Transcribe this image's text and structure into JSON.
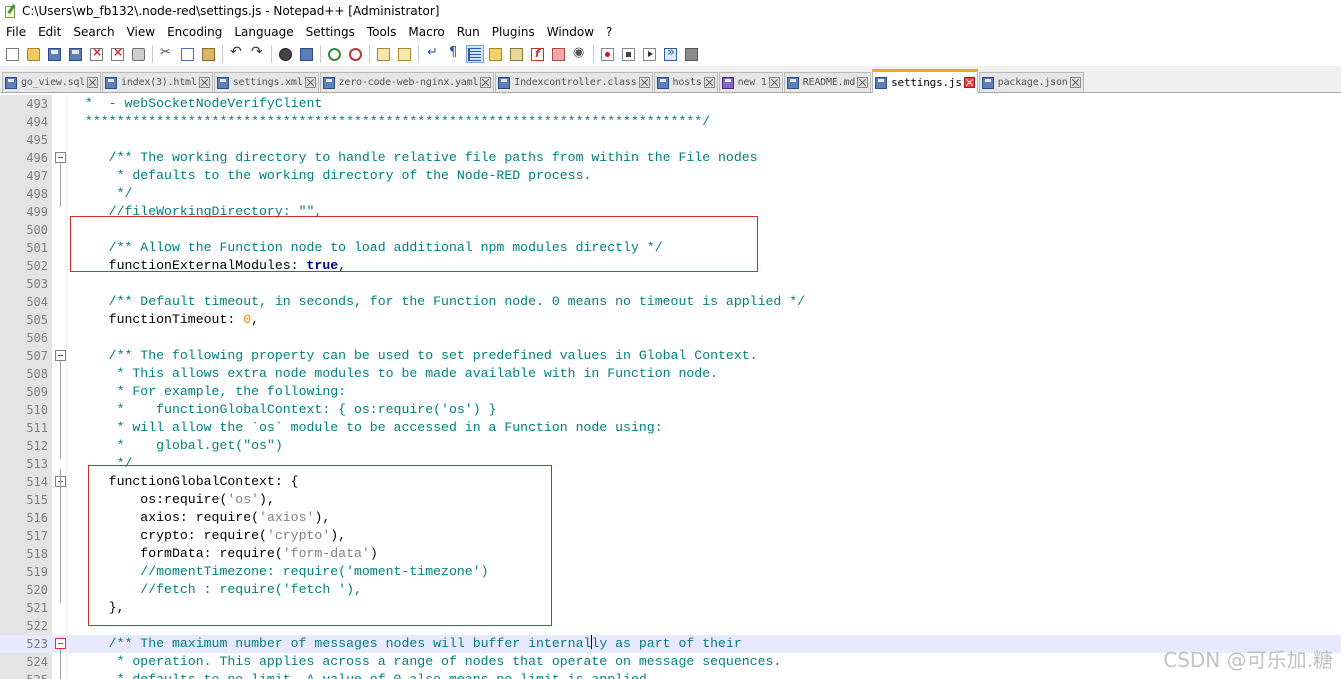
{
  "window": {
    "title": "C:\\Users\\wb_fb132\\.node-red\\settings.js - Notepad++ [Administrator]"
  },
  "menu": [
    "File",
    "Edit",
    "Search",
    "View",
    "Encoding",
    "Language",
    "Settings",
    "Tools",
    "Macro",
    "Run",
    "Plugins",
    "Window",
    "?"
  ],
  "toolbar": {
    "buttons": [
      {
        "name": "new-file-icon",
        "kind": "ic-doc"
      },
      {
        "name": "open-file-icon",
        "kind": "ic-folder"
      },
      {
        "name": "save-icon",
        "kind": "ic-disk"
      },
      {
        "name": "save-all-icon",
        "kind": "ic-disk"
      },
      {
        "name": "close-file-icon",
        "kind": "ic-x"
      },
      {
        "name": "close-all-icon",
        "kind": "ic-x"
      },
      {
        "name": "print-icon",
        "kind": "ic-printer"
      },
      {
        "sep": true
      },
      {
        "name": "cut-icon",
        "kind": "ic-scissors"
      },
      {
        "name": "copy-icon",
        "kind": "ic-copy"
      },
      {
        "name": "paste-icon",
        "kind": "ic-paste"
      },
      {
        "sep": true
      },
      {
        "name": "undo-icon",
        "kind": "ic-undo"
      },
      {
        "name": "redo-icon",
        "kind": "ic-redo"
      },
      {
        "sep": true
      },
      {
        "name": "find-icon",
        "kind": "ic-find"
      },
      {
        "name": "replace-icon",
        "kind": "ic-replace"
      },
      {
        "sep": true
      },
      {
        "name": "zoom-in-icon",
        "kind": "ic-zoomin"
      },
      {
        "name": "zoom-out-icon",
        "kind": "ic-zoomout"
      },
      {
        "sep": true
      },
      {
        "name": "sync-vertical-icon",
        "kind": "ic-sync"
      },
      {
        "name": "sync-horizontal-icon",
        "kind": "ic-sync"
      },
      {
        "sep": true
      },
      {
        "name": "word-wrap-icon",
        "kind": "ic-wrap"
      },
      {
        "name": "show-all-chars-icon",
        "kind": "ic-pilcrow"
      },
      {
        "name": "indent-guide-icon",
        "kind": "ic-indent",
        "active": true
      },
      {
        "name": "user-language-icon",
        "kind": "ic-lang"
      },
      {
        "name": "document-map-icon",
        "kind": "ic-map"
      },
      {
        "name": "function-list-icon",
        "kind": "ic-fx"
      },
      {
        "name": "folder-as-workspace-icon",
        "kind": "ic-openfolder"
      },
      {
        "name": "monitoring-icon",
        "kind": "ic-eye"
      },
      {
        "sep": true
      },
      {
        "name": "record-macro-icon",
        "kind": "ic-rec"
      },
      {
        "name": "stop-recording-icon",
        "kind": "ic-stop"
      },
      {
        "name": "playback-macro-icon",
        "kind": "ic-play"
      },
      {
        "name": "run-macro-multiple-icon",
        "kind": "ic-ff"
      },
      {
        "name": "save-macro-icon",
        "kind": "ic-savemacro"
      }
    ]
  },
  "tabs": [
    {
      "label": "go_view.sql",
      "icon": "disk",
      "active": false
    },
    {
      "label": "index(3).html",
      "icon": "disk",
      "active": false
    },
    {
      "label": "settings.xml",
      "icon": "disk",
      "active": false
    },
    {
      "label": "zero-code-web-nginx.yaml",
      "icon": "disk",
      "active": false
    },
    {
      "label": "Indexcontroller.class",
      "icon": "disk",
      "active": false
    },
    {
      "label": "hosts",
      "icon": "disk",
      "active": false
    },
    {
      "label": "new 1",
      "icon": "purple",
      "active": false
    },
    {
      "label": "README.md",
      "icon": "disk",
      "active": false
    },
    {
      "label": "settings.js",
      "icon": "disk",
      "active": true
    },
    {
      "label": "package.json",
      "icon": "disk",
      "active": false
    }
  ],
  "editor": {
    "lines": [
      {
        "n": "493",
        "fold": "",
        "segs": [
          [
            "c-comment",
            " *  - webSocketNodeVerifyClient"
          ]
        ]
      },
      {
        "n": "494",
        "fold": "",
        "segs": [
          [
            "c-comment",
            " ******************************************************************************/"
          ]
        ]
      },
      {
        "n": "495",
        "fold": "",
        "segs": []
      },
      {
        "n": "496",
        "fold": "box",
        "segs": [
          [
            "c-comment",
            "    /** The working directory to handle relative file paths from within the File nodes"
          ]
        ]
      },
      {
        "n": "497",
        "fold": "",
        "segs": [
          [
            "c-comment",
            "     * defaults to the working directory of the Node-RED process."
          ]
        ]
      },
      {
        "n": "498",
        "fold": "",
        "segs": [
          [
            "c-comment",
            "     */"
          ]
        ]
      },
      {
        "n": "499",
        "fold": "",
        "segs": [
          [
            "c-comment",
            "    //fileWorkingDirectory: \"\","
          ]
        ]
      },
      {
        "n": "500",
        "fold": "",
        "segs": []
      },
      {
        "n": "501",
        "fold": "",
        "segs": [
          [
            "c-comment",
            "    /** Allow the Function node to load additional npm modules directly */"
          ]
        ]
      },
      {
        "n": "502",
        "fold": "",
        "segs": [
          [
            "c-id",
            "    functionExternalModules: "
          ],
          [
            "c-key",
            "true"
          ],
          [
            "c-id",
            ","
          ]
        ]
      },
      {
        "n": "503",
        "fold": "",
        "segs": []
      },
      {
        "n": "504",
        "fold": "",
        "segs": [
          [
            "c-comment",
            "    /** Default timeout, in seconds, for the Function node. 0 means no timeout is applied */"
          ]
        ]
      },
      {
        "n": "505",
        "fold": "",
        "segs": [
          [
            "c-id",
            "    functionTimeout: "
          ],
          [
            "c-num",
            "0"
          ],
          [
            "c-id",
            ","
          ]
        ]
      },
      {
        "n": "506",
        "fold": "",
        "segs": []
      },
      {
        "n": "507",
        "fold": "box",
        "segs": [
          [
            "c-comment",
            "    /** The following property can be used to set predefined values in Global Context."
          ]
        ]
      },
      {
        "n": "508",
        "fold": "",
        "segs": [
          [
            "c-comment",
            "     * This allows extra node modules to be made available with in Function node."
          ]
        ]
      },
      {
        "n": "509",
        "fold": "",
        "segs": [
          [
            "c-comment",
            "     * For example, the following:"
          ]
        ]
      },
      {
        "n": "510",
        "fold": "",
        "segs": [
          [
            "c-comment",
            "     *    functionGlobalContext: { os:require('os') }"
          ]
        ]
      },
      {
        "n": "511",
        "fold": "",
        "segs": [
          [
            "c-comment",
            "     * will allow the `os` module to be accessed in a Function node using:"
          ]
        ]
      },
      {
        "n": "512",
        "fold": "",
        "segs": [
          [
            "c-comment",
            "     *    global.get(\"os\")"
          ]
        ]
      },
      {
        "n": "513",
        "fold": "",
        "segs": [
          [
            "c-comment",
            "     */"
          ]
        ]
      },
      {
        "n": "514",
        "fold": "box",
        "segs": [
          [
            "c-id",
            "    functionGlobalContext: {"
          ]
        ]
      },
      {
        "n": "515",
        "fold": "",
        "segs": [
          [
            "c-id",
            "        os:require("
          ],
          [
            "c-str",
            "'os'"
          ],
          [
            "c-id",
            "),"
          ]
        ]
      },
      {
        "n": "516",
        "fold": "",
        "segs": [
          [
            "c-id",
            "        axios: require("
          ],
          [
            "c-str",
            "'axios'"
          ],
          [
            "c-id",
            "),"
          ]
        ]
      },
      {
        "n": "517",
        "fold": "",
        "segs": [
          [
            "c-id",
            "        crypto: require("
          ],
          [
            "c-str",
            "'crypto'"
          ],
          [
            "c-id",
            "),"
          ]
        ]
      },
      {
        "n": "518",
        "fold": "",
        "segs": [
          [
            "c-id",
            "        formData: require("
          ],
          [
            "c-str",
            "'form-data'"
          ],
          [
            "c-id",
            ")"
          ]
        ]
      },
      {
        "n": "519",
        "fold": "",
        "segs": [
          [
            "c-comment",
            "        //momentTimezone: require('moment-timezone')"
          ]
        ]
      },
      {
        "n": "520",
        "fold": "",
        "segs": [
          [
            "c-comment",
            "        //fetch : require('fetch '),"
          ]
        ]
      },
      {
        "n": "521",
        "fold": "",
        "segs": [
          [
            "c-id",
            "    },"
          ]
        ]
      },
      {
        "n": "522",
        "fold": "",
        "segs": []
      },
      {
        "n": "523",
        "fold": "red",
        "current": true,
        "segs": [
          [
            "c-comment",
            "    /** The maximum number of messages nodes will buffer internal"
          ],
          [
            "caret",
            ""
          ],
          [
            "c-comment",
            "ly as part of their"
          ]
        ]
      },
      {
        "n": "524",
        "fold": "",
        "segs": [
          [
            "c-comment",
            "     * operation. This applies across a range of nodes that operate on message sequences."
          ]
        ]
      },
      {
        "n": "525",
        "fold": "",
        "segs": [
          [
            "c-comment",
            "     * defaults to no limit. A value of 0 also means no limit is applied."
          ]
        ]
      }
    ]
  },
  "watermark": "CSDN @可乐加.糖",
  "colors": {
    "comment": "#008080",
    "keyword": "#000080",
    "string": "#808080",
    "number": "#ff8000",
    "highlight_box": "#d62a2a",
    "active_tab_accent": "#f5a623"
  }
}
